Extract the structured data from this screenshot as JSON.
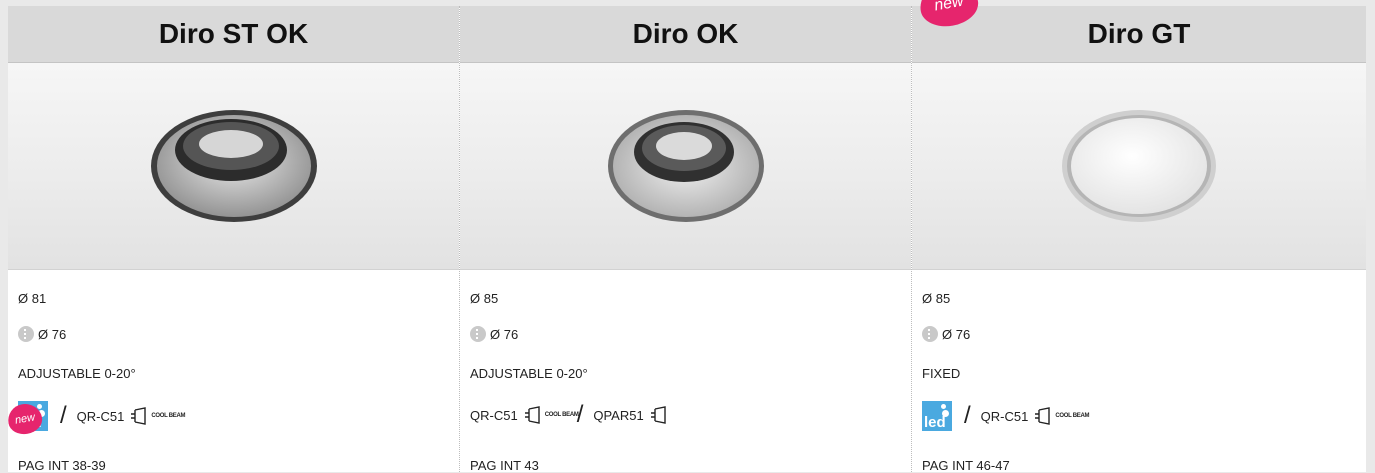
{
  "columns": [
    {
      "title": "Diro ST OK",
      "diameter": "Ø 81",
      "cutout": "Ø 76",
      "mode": "ADJUSTABLE 0-20°",
      "lamp1": "QR-C51",
      "lamp2": "",
      "page": "PAG INT 38-39"
    },
    {
      "title": "Diro OK",
      "diameter": "Ø 85",
      "cutout": "Ø 76",
      "mode": "ADJUSTABLE 0-20°",
      "lamp1": "QR-C51",
      "lamp2": "QPAR51",
      "page": "PAG INT 43"
    },
    {
      "title": "Diro GT",
      "diameter": "Ø 85",
      "cutout": "Ø 76",
      "mode": "FIXED",
      "lamp1": "QR-C51",
      "lamp2": "",
      "page": "PAG INT 46-47"
    }
  ],
  "icons": {
    "led_label": "led",
    "cool_beam_label": "COOL BEAM",
    "new_label": "new",
    "separator": "/"
  },
  "colors": {
    "header_bg": "#d9d9d9",
    "led_blue": "#4aa9e0",
    "new_pink": "#e6256d"
  }
}
